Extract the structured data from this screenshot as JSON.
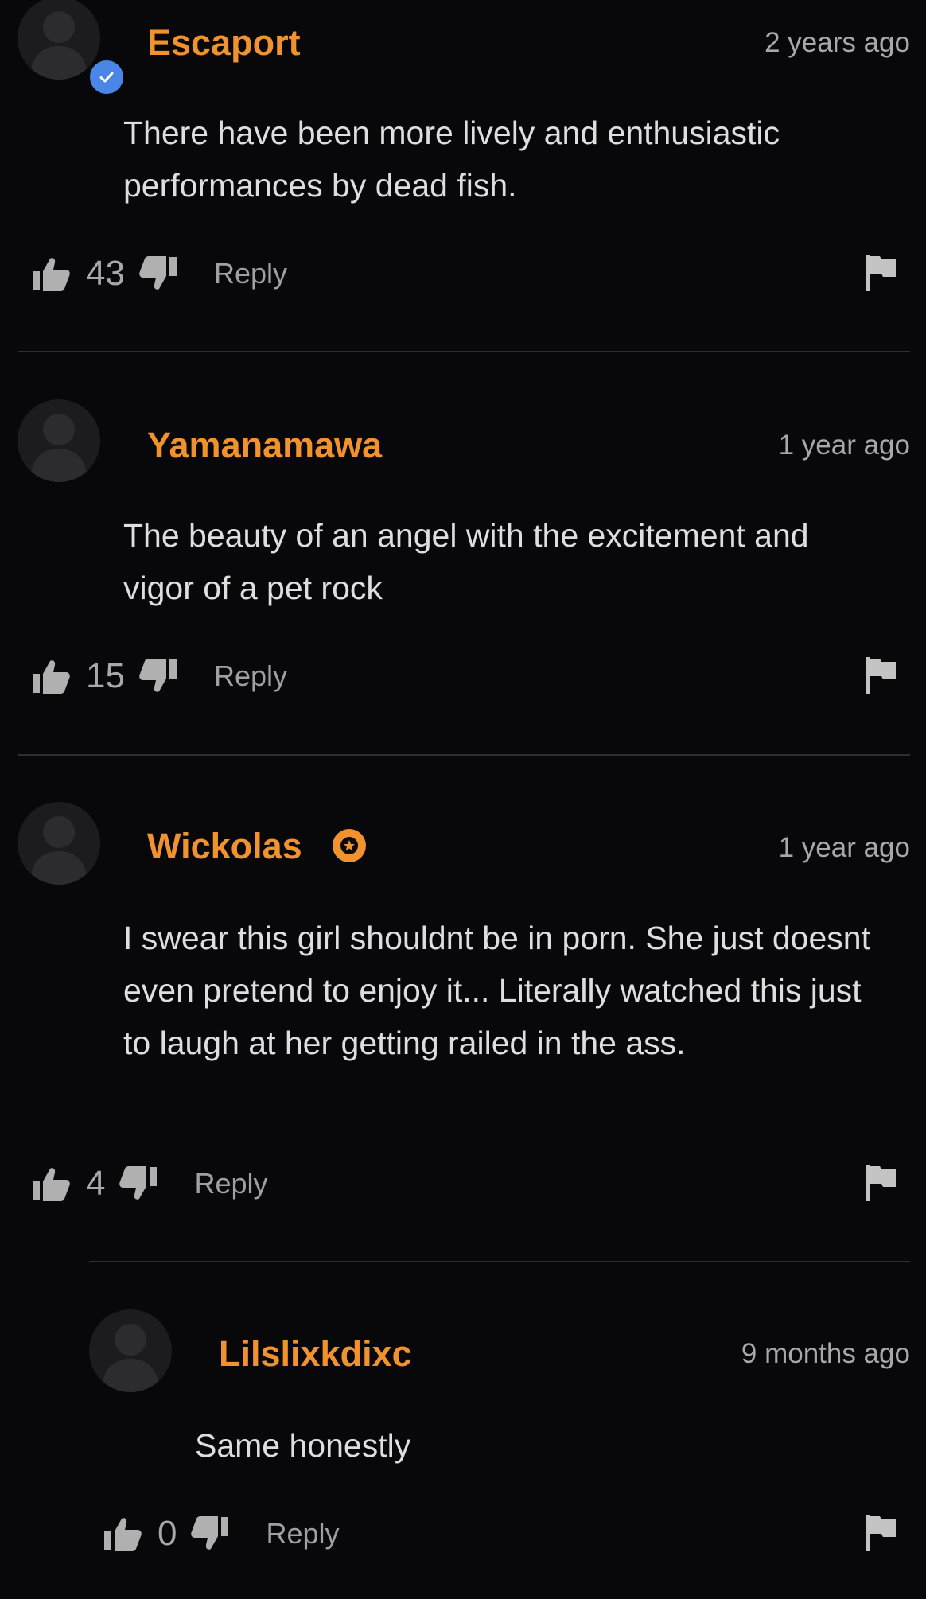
{
  "colors": {
    "username": "#f0922e",
    "verified_badge": "#4a86e8",
    "star_badge": "#f0922e",
    "background": "#08080a",
    "divider": "#2e2e30"
  },
  "comments": [
    {
      "username": "Escaport",
      "timestamp": "2 years ago",
      "text": "There have been more lively and enthusiastic performances by dead fish.",
      "votes": "43",
      "reply_label": "Reply",
      "badge": "verified-icon"
    },
    {
      "username": "Yamanamawa",
      "timestamp": "1 year ago",
      "text": "The beauty of an angel with the excitement and vigor of a pet rock",
      "votes": "15",
      "reply_label": "Reply",
      "badge": ""
    },
    {
      "username": "Wickolas",
      "timestamp": "1 year ago",
      "text": "I swear this girl shouldnt be in porn. She just doesnt even pretend to enjoy it... Literally watched this just to laugh at her getting railed in the ass.",
      "votes": "4",
      "reply_label": "Reply",
      "badge": "star-icon"
    },
    {
      "username": "Lilslixkdixc",
      "timestamp": "9 months ago",
      "text": "Same honestly",
      "votes": "0",
      "reply_label": "Reply",
      "badge": "",
      "is_reply": true
    }
  ]
}
